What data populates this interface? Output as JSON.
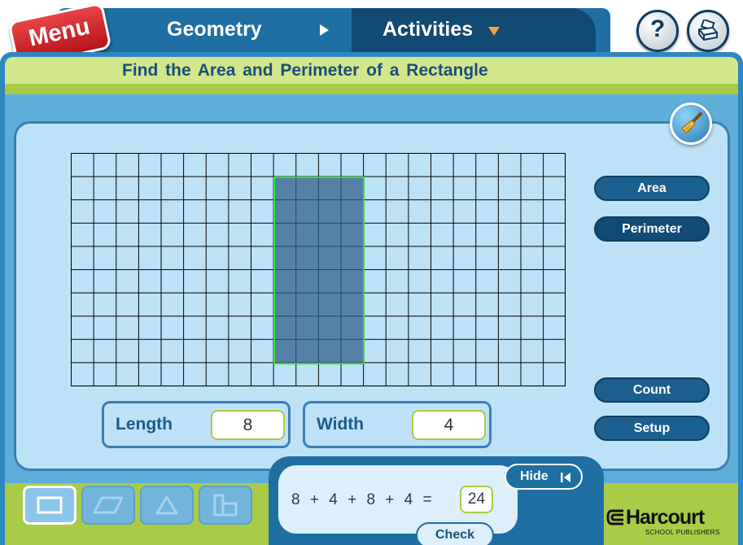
{
  "header": {
    "menu_label": "Menu",
    "breadcrumb": "Geometry",
    "section": "Activities",
    "icons": {
      "breadcrumb_separator": "play-arrow-icon",
      "dropdown": "dropdown-arrow-icon",
      "help": "help-icon",
      "print": "print-icon"
    },
    "help_glyph": "?"
  },
  "page_title": "Find the Area and Perimeter of a Rectangle",
  "tools": {
    "clear_icon": "broom-icon"
  },
  "grid": {
    "columns": 22,
    "rows": 10,
    "rectangle": {
      "col_start": 9,
      "row_start": 1,
      "cols": 4,
      "rows": 8,
      "fill": "#2e5c86",
      "outline": "#2fe12f"
    }
  },
  "side_buttons": {
    "area": "Area",
    "perimeter": "Perimeter",
    "count": "Count",
    "setup": "Setup"
  },
  "fields": {
    "length_label": "Length",
    "length_value": "8",
    "width_label": "Width",
    "width_value": "4"
  },
  "equation": {
    "expression": "8 + 4 + 8 + 4 =",
    "answer": "24"
  },
  "controls": {
    "hide_label": "Hide",
    "hide_icon": "skip-back-icon",
    "check_label": "Check"
  },
  "shape_tabs": [
    {
      "name": "rectangle",
      "icon": "rectangle-icon",
      "active": true
    },
    {
      "name": "parallelogram",
      "icon": "parallelogram-icon",
      "active": false
    },
    {
      "name": "triangle",
      "icon": "triangle-icon",
      "active": false
    },
    {
      "name": "composite",
      "icon": "composite-shape-icon",
      "active": false
    }
  ],
  "publisher": {
    "name": "Harcourt",
    "tagline": "SCHOOL PUBLISHERS"
  },
  "colors": {
    "header_blue": "#1f6fa3",
    "tab_dark": "#114a73",
    "title_band": "#d2e68c",
    "accent_green": "#a8cc46",
    "menu_red": "#c8202a",
    "dropdown_orange": "#f4a13a",
    "work_area": "#bde2f8"
  }
}
